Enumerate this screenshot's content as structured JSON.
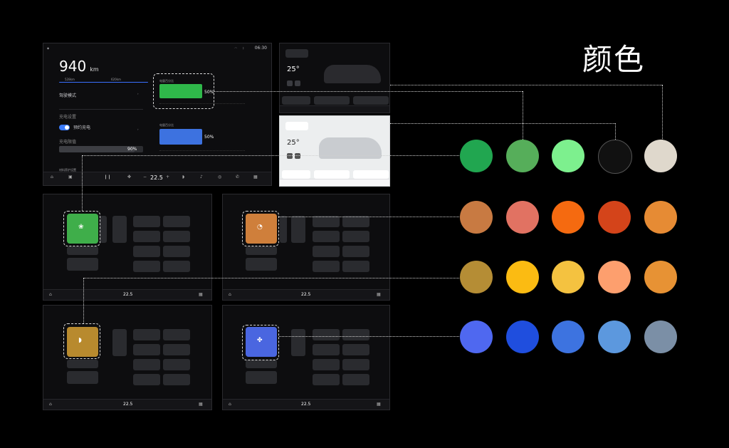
{
  "title": "颜色",
  "main_screen": {
    "status_time": "06:30",
    "range_value": "940",
    "range_unit": "km",
    "range_sub_a": "528km",
    "range_sub_b": "620km",
    "row_label_1": "驾驶模式",
    "section_charging": "充电设置",
    "row_label_2": "预约充电",
    "row_label_3": "充电限值",
    "charge_limit": "90%",
    "section_bottom": "材料养护设置",
    "battery_label": "电量百分比",
    "battery_pct": "50%",
    "battery_pct_2": "50%",
    "dock_temp": "22.5"
  },
  "light_screen_top": {
    "temp": "25°"
  },
  "light_screen_bottom": {
    "temp": "25°"
  },
  "widget_screens": [
    {
      "temp": "22.5",
      "accent": "#3fae4a"
    },
    {
      "temp": "22.5",
      "accent": "#cf7f3b"
    },
    {
      "temp": "22.5",
      "accent": "#b88a2e"
    },
    {
      "temp": "22.5",
      "accent": "#4a66e0"
    }
  ],
  "palette": {
    "greens": [
      "#21a650",
      "#56ae5a",
      "#7df08e",
      "#111111",
      "#dfd8cc"
    ],
    "oranges": [
      "#c87a42",
      "#e17262",
      "#f56a10",
      "#d4441a",
      "#e68b34"
    ],
    "yellows": [
      "#b58d35",
      "#fbbb12",
      "#f4c240",
      "#fd9f6e",
      "#e79234"
    ],
    "blues": [
      "#4f68f0",
      "#1f4ede",
      "#3d73e0",
      "#5c98de",
      "#7b8fa6"
    ]
  }
}
